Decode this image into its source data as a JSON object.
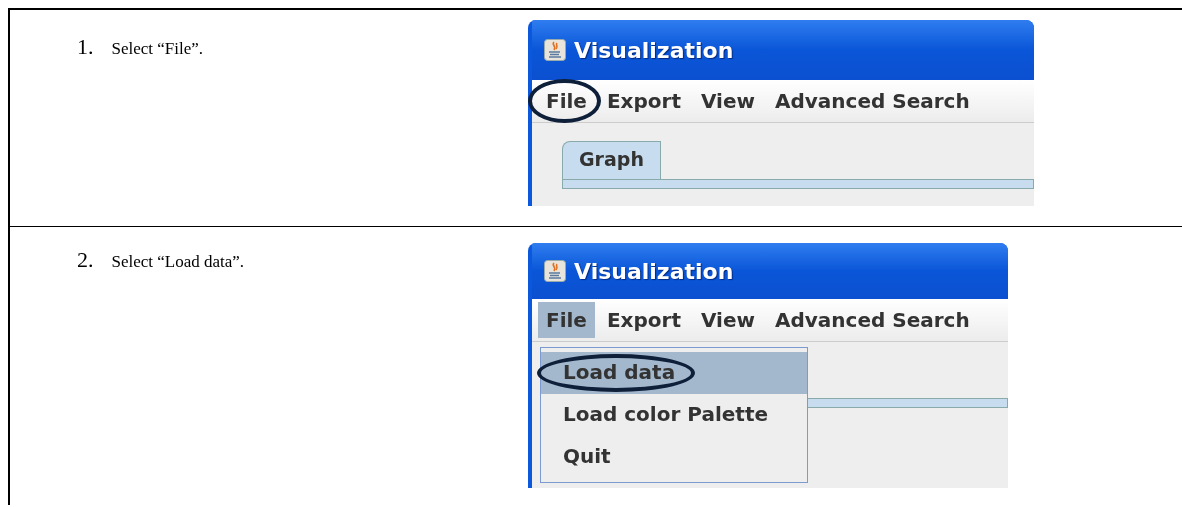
{
  "steps": [
    {
      "number": "1.",
      "text": "Select “File”.",
      "screenshot": {
        "title": "Visualization",
        "menus": [
          {
            "label": "File",
            "selected": false,
            "circled": true
          },
          {
            "label": "Export",
            "selected": false,
            "circled": false
          },
          {
            "label": "View",
            "selected": false,
            "circled": false
          },
          {
            "label": "Advanced Search",
            "selected": false,
            "circled": false
          }
        ],
        "tabs": [
          {
            "label": "Graph",
            "selected": true
          }
        ]
      }
    },
    {
      "number": "2.",
      "text": "Select “Load data”.",
      "screenshot": {
        "title": "Visualization",
        "menus": [
          {
            "label": "File",
            "selected": true,
            "circled": false
          },
          {
            "label": "Export",
            "selected": false,
            "circled": false
          },
          {
            "label": "View",
            "selected": false,
            "circled": false
          },
          {
            "label": "Advanced Search",
            "selected": false,
            "circled": false
          }
        ],
        "dropdown": [
          {
            "label": "Load data",
            "selected": true,
            "circled": true
          },
          {
            "label": "Load color Palette",
            "selected": false,
            "circled": false
          },
          {
            "label": "Quit",
            "selected": false,
            "circled": false
          }
        ]
      }
    }
  ]
}
